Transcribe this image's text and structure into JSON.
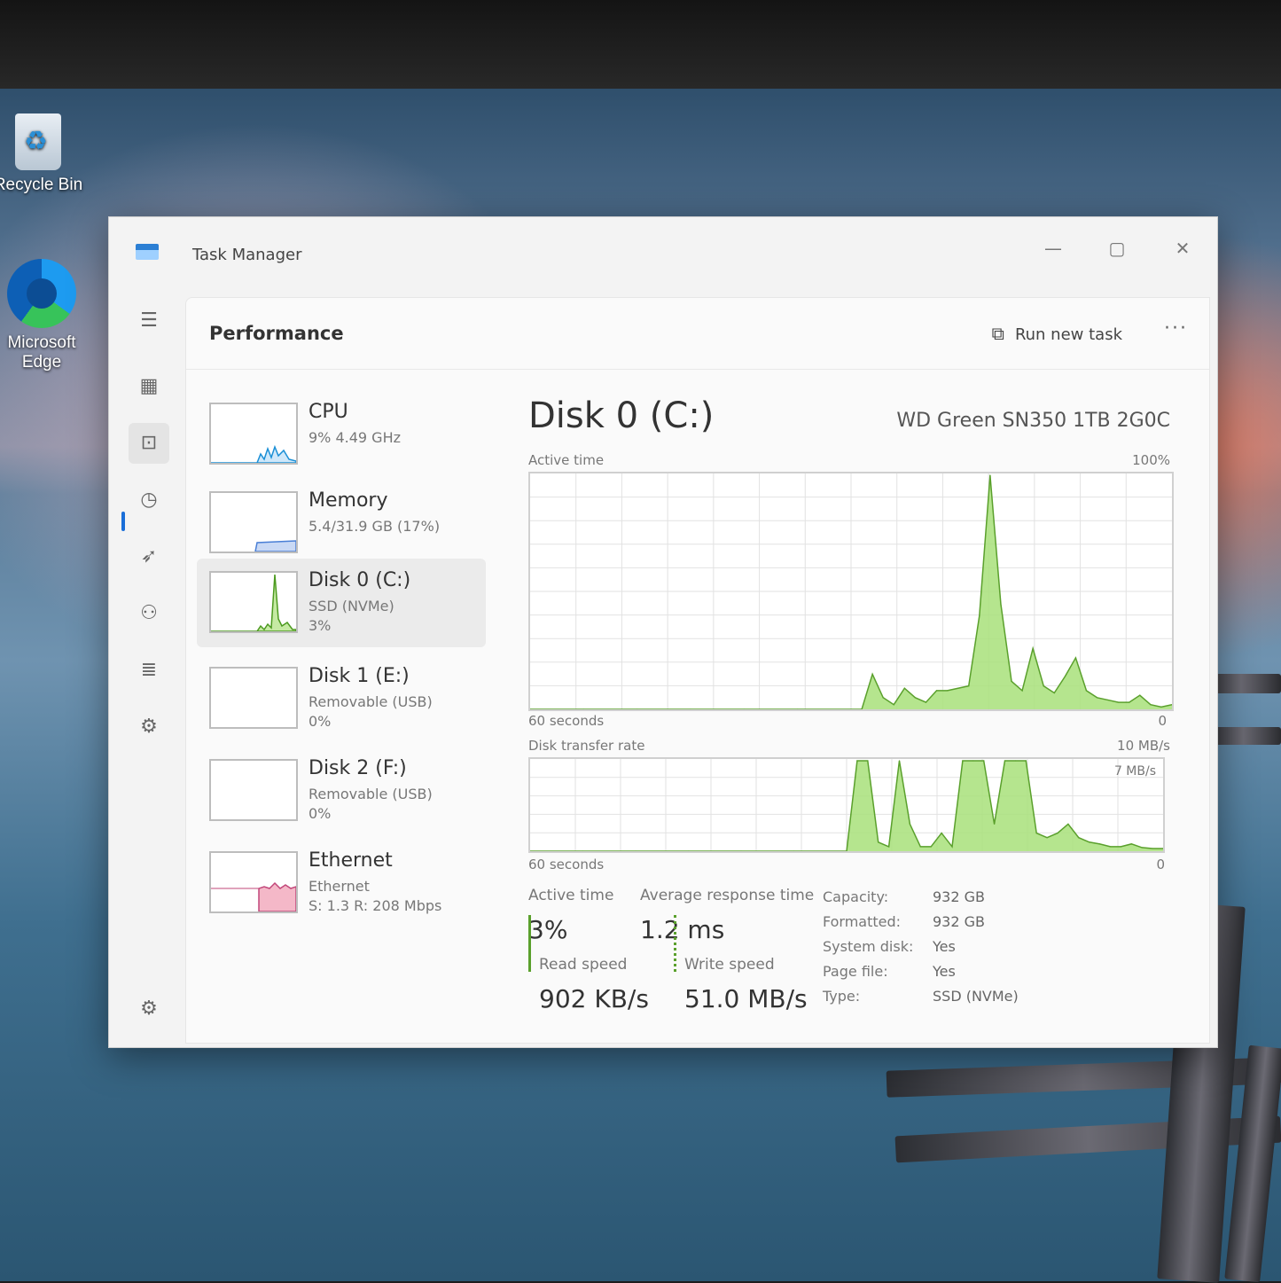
{
  "desktop": {
    "icons": [
      {
        "label": "Recycle Bin",
        "icon": "recycle-bin-icon"
      },
      {
        "label": "Microsoft Edge",
        "icon": "edge-icon"
      }
    ]
  },
  "window": {
    "title": "Task Manager",
    "controls": {
      "minimize": "—",
      "maximize": "▢",
      "close": "✕"
    }
  },
  "nav": {
    "items": [
      {
        "name": "hamburger-menu-icon",
        "glyph": "☰"
      },
      {
        "name": "processes-icon",
        "glyph": "▦"
      },
      {
        "name": "performance-icon",
        "glyph": "⊡",
        "active": true
      },
      {
        "name": "app-history-icon",
        "glyph": "◷"
      },
      {
        "name": "startup-apps-icon",
        "glyph": "➶"
      },
      {
        "name": "users-icon",
        "glyph": "⚇"
      },
      {
        "name": "details-icon",
        "glyph": "≣"
      },
      {
        "name": "services-icon",
        "glyph": "⚙"
      },
      {
        "name": "settings-icon",
        "glyph": "⚙"
      }
    ]
  },
  "header": {
    "title": "Performance",
    "run_new_task": "Run new task",
    "more": "···"
  },
  "devices": [
    {
      "name": "CPU",
      "sub": "9% 4.49 GHz",
      "sub2": "",
      "color": "#1a8fd6"
    },
    {
      "name": "Memory",
      "sub": "5.4/31.9 GB (17%)",
      "sub2": "",
      "color": "#7a4fc9"
    },
    {
      "name": "Disk 0 (C:)",
      "sub": "SSD (NVMe)",
      "sub2": "3%",
      "color": "#4c9a1f",
      "selected": true
    },
    {
      "name": "Disk 1 (E:)",
      "sub": "Removable (USB)",
      "sub2": "0%",
      "color": "#4c9a1f"
    },
    {
      "name": "Disk 2 (F:)",
      "sub": "Removable (USB)",
      "sub2": "0%",
      "color": "#4c9a1f"
    },
    {
      "name": "Ethernet",
      "sub": "Ethernet",
      "sub2": "S: 1.3 R: 208 Mbps",
      "color": "#c2477a"
    }
  ],
  "detail": {
    "title": "Disk 0 (C:)",
    "model": "WD Green SN350 1TB 2G0C",
    "active_time_label": "Active time",
    "active_time_max": "100%",
    "seconds_label": "60 seconds",
    "zero": "0",
    "transfer_label": "Disk transfer rate",
    "transfer_max": "10 MB/s",
    "transfer_mid": "7 MB/s",
    "graph_color": "#a8e07a",
    "graph_line": "#5aa02c"
  },
  "chart_data": [
    {
      "type": "area",
      "title": "Active time",
      "xlabel": "60 seconds",
      "ylim": [
        0,
        100
      ],
      "x": [
        0,
        5,
        10,
        15,
        20,
        25,
        30,
        31,
        32,
        33,
        34,
        35,
        36,
        37,
        38,
        39,
        40,
        41,
        42,
        43,
        44,
        45,
        46,
        47,
        48,
        49,
        50,
        51,
        52,
        53,
        54,
        55,
        56,
        57,
        58,
        59,
        60
      ],
      "values": [
        0,
        0,
        0,
        0,
        0,
        0,
        0,
        0,
        15,
        5,
        2,
        9,
        5,
        3,
        8,
        8,
        9,
        10,
        40,
        100,
        45,
        12,
        8,
        26,
        10,
        7,
        14,
        22,
        8,
        5,
        4,
        3,
        3,
        6,
        2,
        1,
        2
      ]
    },
    {
      "type": "area",
      "title": "Disk transfer rate",
      "xlabel": "60 seconds",
      "ylim": [
        0,
        10
      ],
      "x": [
        0,
        5,
        10,
        15,
        20,
        25,
        30,
        31,
        32,
        33,
        34,
        35,
        36,
        37,
        38,
        39,
        40,
        41,
        42,
        43,
        44,
        45,
        46,
        47,
        48,
        49,
        50,
        51,
        52,
        53,
        54,
        55,
        56,
        57,
        58,
        59,
        60
      ],
      "values": [
        0,
        0,
        0,
        0,
        0,
        0,
        0,
        10,
        10,
        1,
        0.5,
        10,
        3,
        0.5,
        0.5,
        2,
        0.5,
        10,
        10,
        10,
        3,
        10,
        10,
        10,
        2,
        1.5,
        2,
        3,
        1.5,
        1,
        0.8,
        0.5,
        0.5,
        0.8,
        0.4,
        0.3,
        0.3
      ]
    }
  ],
  "stats": {
    "active_time_k": "Active time",
    "active_time_v": "3%",
    "resp_k": "Average response time",
    "resp_v": "1.2 ms",
    "read_k": "Read speed",
    "read_v": "902 KB/s",
    "write_k": "Write speed",
    "write_v": "51.0 MB/s",
    "rows": [
      {
        "k": "Capacity:",
        "v": "932 GB"
      },
      {
        "k": "Formatted:",
        "v": "932 GB"
      },
      {
        "k": "System disk:",
        "v": "Yes"
      },
      {
        "k": "Page file:",
        "v": "Yes"
      },
      {
        "k": "Type:",
        "v": "SSD (NVMe)"
      }
    ]
  }
}
